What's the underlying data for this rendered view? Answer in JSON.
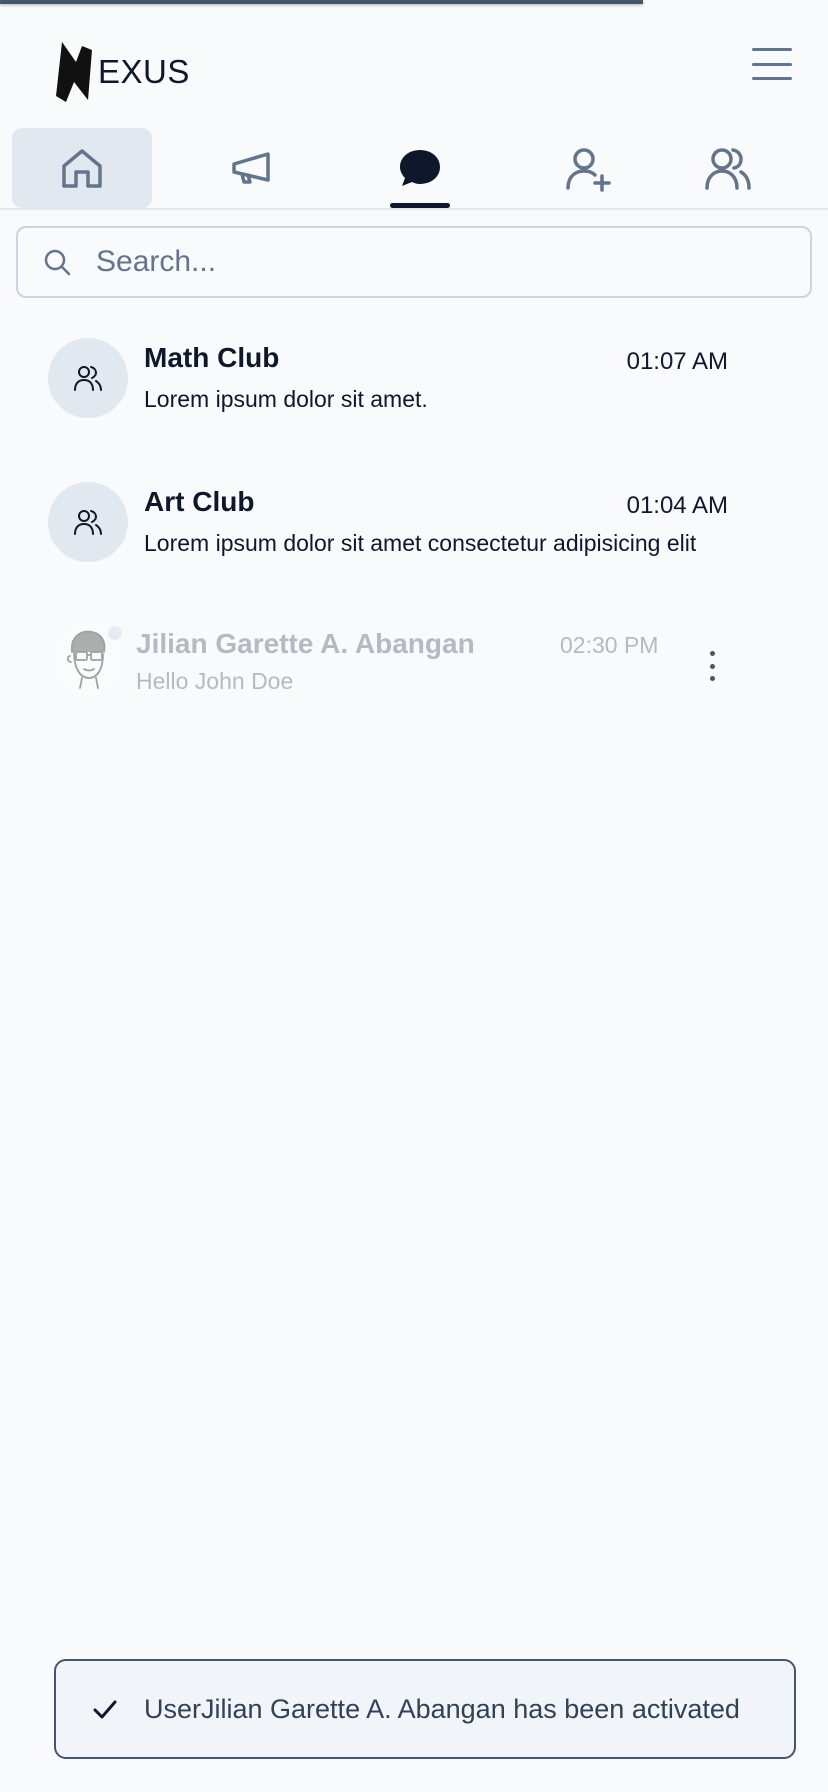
{
  "app": {
    "logo_text": "EXUS"
  },
  "tabs": [
    {
      "name": "home",
      "icon": "home-icon",
      "active": false
    },
    {
      "name": "announcements",
      "icon": "megaphone-icon",
      "active": false
    },
    {
      "name": "chats",
      "icon": "chat-bubble-icon",
      "active": true
    },
    {
      "name": "add-friend",
      "icon": "user-plus-icon",
      "active": false
    },
    {
      "name": "friends",
      "icon": "users-icon",
      "active": false
    }
  ],
  "search": {
    "placeholder": "Search..."
  },
  "groups": [
    {
      "name": "Math Club",
      "time": "01:07 AM",
      "message": "Lorem ipsum dolor sit amet."
    },
    {
      "name": "Art Club",
      "time": "01:04 AM",
      "message": "Lorem ipsum dolor sit amet consectetur adipisicing elit"
    }
  ],
  "direct": {
    "name": "Jilian Garette A. Abangan",
    "time": "02:30 PM",
    "message": "Hello John Doe"
  },
  "toast": {
    "text": "UserJilian Garette A. Abangan has been activated"
  },
  "colors": {
    "accent": "#0f172a",
    "muted": "#64748b",
    "surface": "#f8fafc",
    "active_tab": "#e2e8f0"
  }
}
